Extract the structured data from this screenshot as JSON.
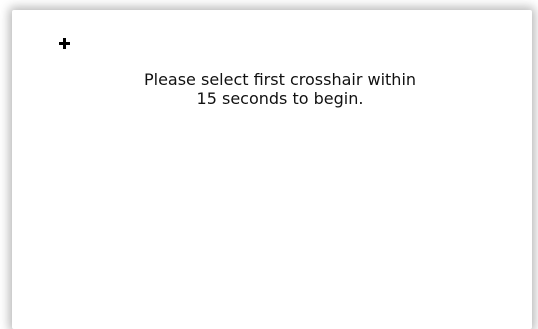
{
  "prompt": {
    "line1": "Please select first crosshair within",
    "line2": "15 seconds to begin."
  },
  "icons": {
    "crosshair": "crosshair-target"
  }
}
